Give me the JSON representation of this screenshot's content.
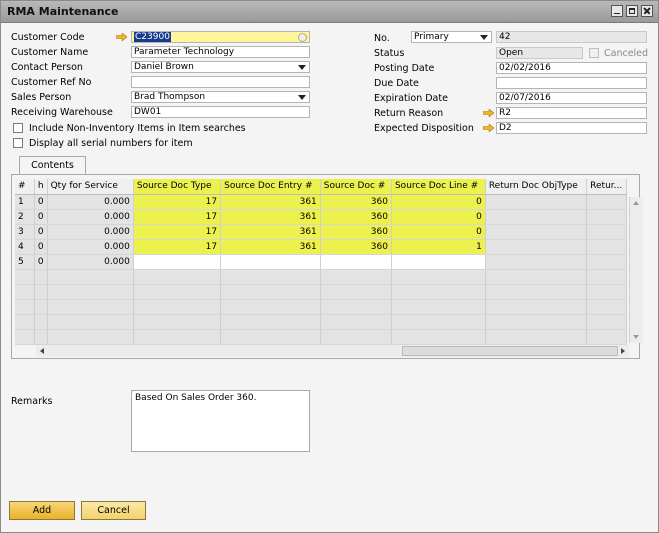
{
  "window": {
    "title": "RMA Maintenance"
  },
  "left_fields": {
    "customer_code": {
      "label": "Customer Code",
      "value": "C23900"
    },
    "customer_name": {
      "label": "Customer Name",
      "value": "Parameter Technology"
    },
    "contact_person": {
      "label": "Contact Person",
      "value": "Daniel Brown"
    },
    "customer_ref_no": {
      "label": "Customer Ref No",
      "value": ""
    },
    "sales_person": {
      "label": "Sales Person",
      "value": "Brad Thompson"
    },
    "receiving_warehouse": {
      "label": "Receiving Warehouse",
      "value": "DW01"
    }
  },
  "checkboxes": {
    "include_non_inventory": "Include Non-Inventory Items in Item searches",
    "display_serials": "Display all serial numbers for item"
  },
  "right_fields": {
    "no": {
      "label": "No.",
      "series": "Primary",
      "value": "42"
    },
    "status": {
      "label": "Status",
      "value": "Open",
      "canceled_label": "Canceled"
    },
    "posting_date": {
      "label": "Posting Date",
      "value": "02/02/2016"
    },
    "due_date": {
      "label": "Due Date",
      "value": ""
    },
    "expiration_date": {
      "label": "Expiration Date",
      "value": "02/07/2016"
    },
    "return_reason": {
      "label": "Return Reason",
      "value": "R2"
    },
    "expected_disposition": {
      "label": "Expected Disposition",
      "value": "D2"
    }
  },
  "tabs": [
    {
      "label": "Contents"
    }
  ],
  "grid": {
    "columns": [
      "#",
      "h",
      "Qty for Service",
      "Source Doc Type",
      "Source Doc Entry #",
      "Source Doc #",
      "Source Doc Line #",
      "Return Doc ObjType",
      "Retur..."
    ],
    "rows": [
      [
        "1",
        "0",
        "0.000",
        "17",
        "361",
        "360",
        "0",
        "",
        ""
      ],
      [
        "2",
        "0",
        "0.000",
        "17",
        "361",
        "360",
        "0",
        "",
        ""
      ],
      [
        "3",
        "0",
        "0.000",
        "17",
        "361",
        "360",
        "0",
        "",
        ""
      ],
      [
        "4",
        "0",
        "0.000",
        "17",
        "361",
        "360",
        "1",
        "",
        ""
      ],
      [
        "5",
        "0",
        "0.000",
        "",
        "",
        "",
        "",
        "",
        ""
      ]
    ],
    "highlight_color": "#ecf14e"
  },
  "remarks": {
    "label": "Remarks",
    "value": "Based On Sales Order 360."
  },
  "buttons": {
    "add": "Add",
    "cancel": "Cancel"
  }
}
